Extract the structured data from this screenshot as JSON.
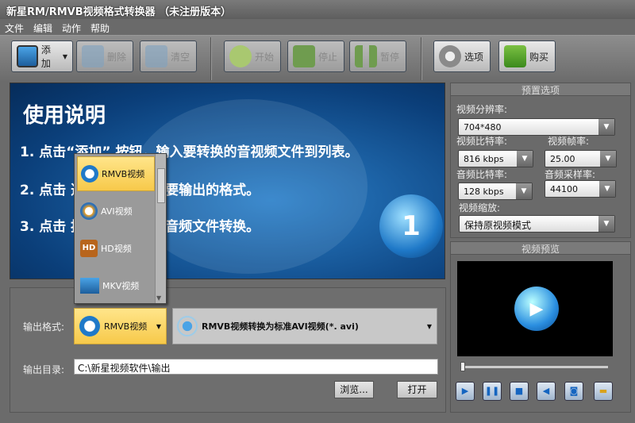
{
  "window": {
    "title": "新星RM/RMVB视频格式转换器 （未注册版本）"
  },
  "menu": [
    "文件",
    "编辑",
    "动作",
    "帮助"
  ],
  "toolbar": {
    "add": "添加",
    "delete": "删除",
    "clear": "清空",
    "start": "开始",
    "stop": "停止",
    "pause": "暂停",
    "options": "选项",
    "buy": "购买"
  },
  "banner": {
    "title": "使用说明",
    "step1": "1. 点击“添加”   按钮，输入要转换的音视频文件到列表。",
    "step2": "2. 点击                选项框，选择您要输出的格式。",
    "step3": "3. 点击                按钮，开始视频音频文件转换。",
    "badge": "1"
  },
  "format_popup": {
    "items": [
      "RMVB视频",
      "AVI视频",
      "HD视频",
      "MKV视频"
    ],
    "selected": "RMVB视频",
    "hd_badge": "HD"
  },
  "output": {
    "format_label": "输出格式:",
    "format_value": "RMVB视频",
    "profile_value": "RMVB视频转换为标准AVI视频(*. avi)",
    "dir_label": "输出目录:",
    "dir_value": "C:\\新星视频软件\\输出",
    "browse": "浏览...",
    "open": "打开"
  },
  "presets": {
    "title": "预置选项",
    "resolution_label": "视频分辨率:",
    "resolution": "704*480",
    "vbitrate_label": "视频比特率:",
    "vbitrate": "816 kbps",
    "fps_label": "视频帧率:",
    "fps": "25.00",
    "abitrate_label": "音频比特率:",
    "abitrate": "128 kbps",
    "samplerate_label": "音频采样率:",
    "samplerate": "44100",
    "scale_label": "视频缩放:",
    "scale": "保持原视频模式"
  },
  "preview": {
    "title": "视频预览",
    "seek_position": 0
  }
}
